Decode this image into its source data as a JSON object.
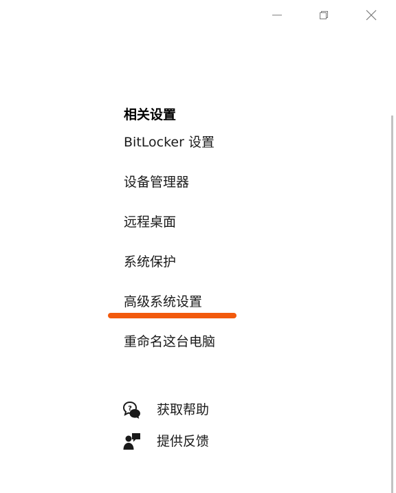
{
  "window_controls": {
    "minimize_icon": "minimize-icon",
    "maximize_icon": "restore-icon",
    "close_icon": "close-icon"
  },
  "related_settings": {
    "title": "相关设置",
    "links": [
      "BitLocker 设置",
      "设备管理器",
      "远程桌面",
      "系统保护",
      "高级系统设置",
      "重命名这台电脑"
    ]
  },
  "highlight": {
    "target": "高级系统设置",
    "color": "#f25a0d"
  },
  "support": {
    "get_help": {
      "label": "获取帮助",
      "icon": "chat-help-icon"
    },
    "feedback": {
      "label": "提供反馈",
      "icon": "feedback-person-icon"
    }
  }
}
